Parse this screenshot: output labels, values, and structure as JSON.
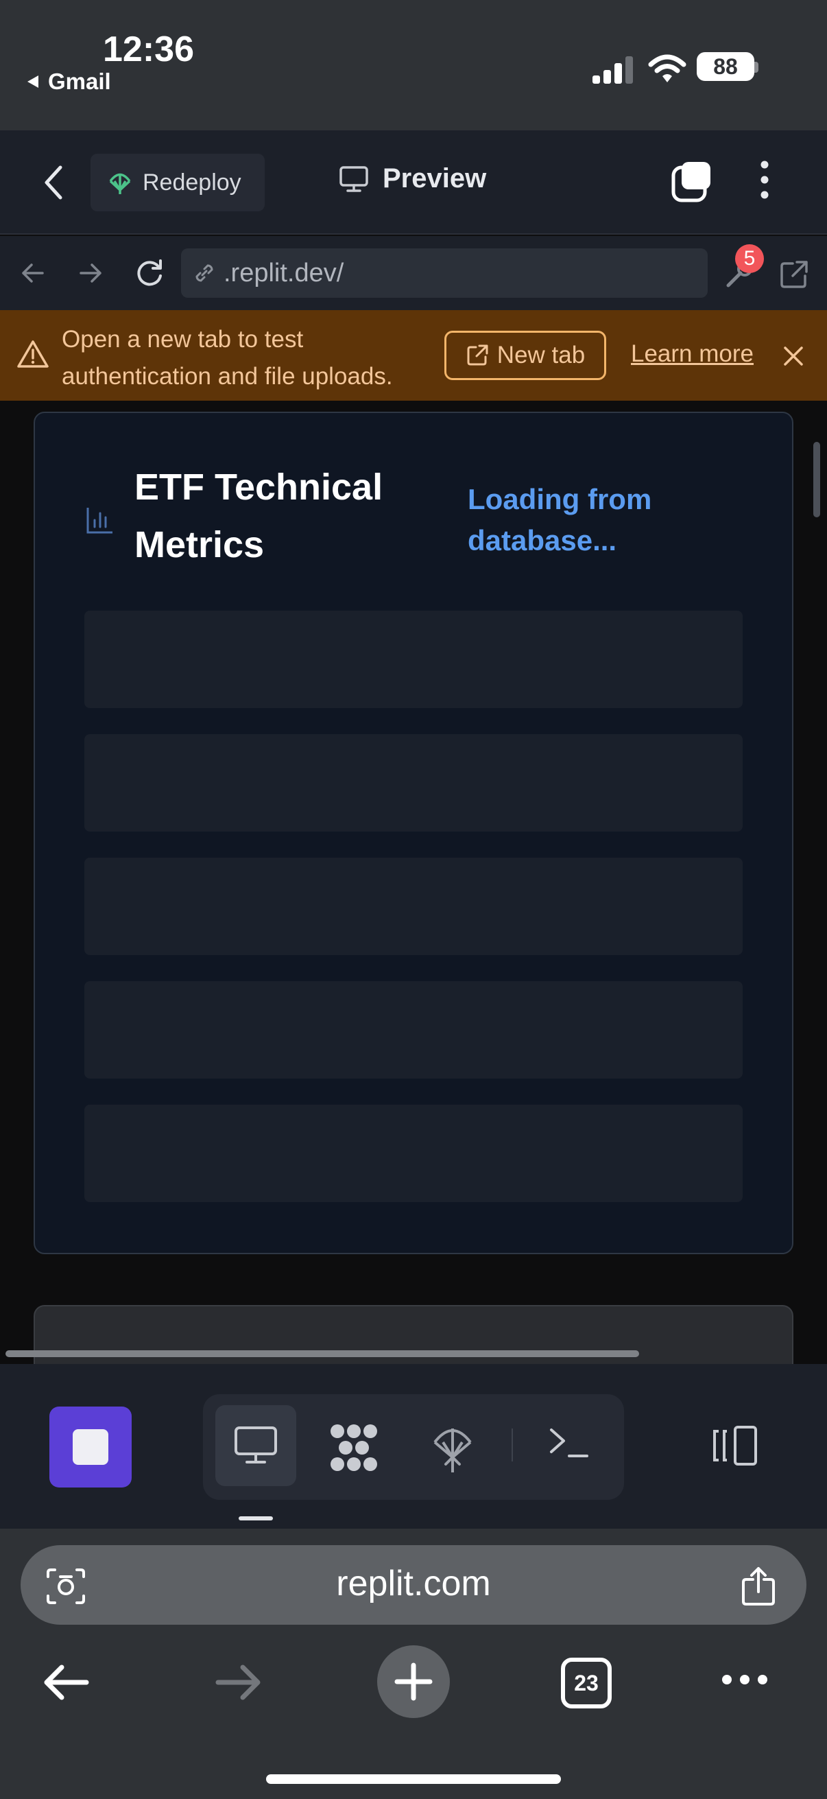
{
  "status_bar": {
    "time": "12:36",
    "back_app": "Gmail",
    "battery": "88"
  },
  "replit_header": {
    "redeploy_label": "Redeploy",
    "preview_label": "Preview"
  },
  "browser_bar": {
    "url": ".replit.dev/",
    "tools_badge": "5"
  },
  "banner": {
    "message": "Open a new tab to test authentication and file uploads.",
    "new_tab_label": "New tab",
    "learn_more_label": "Learn more"
  },
  "card": {
    "title": "ETF Technical Metrics",
    "loading": "Loading from database...",
    "skeleton_rows": 5
  },
  "safari": {
    "address": "replit.com",
    "tab_count": "23"
  },
  "colors": {
    "accent_purple": "#5b3fd6",
    "banner_bg": "#5e3408",
    "loading_blue": "#5b9cf0",
    "deploy_green": "#4cc38a",
    "badge_red": "#f2555a"
  }
}
